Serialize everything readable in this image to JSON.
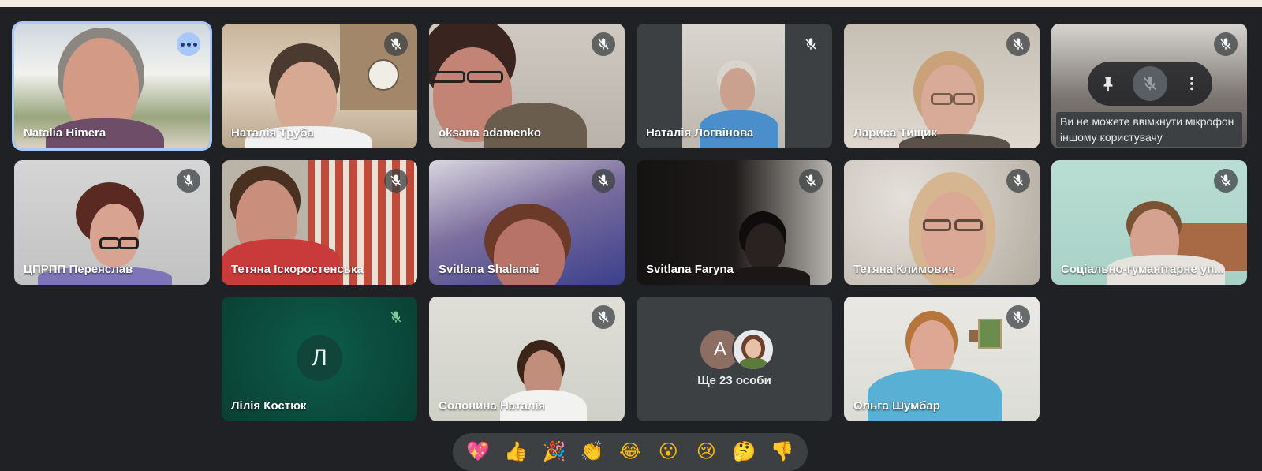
{
  "participants": [
    {
      "name": "Natalia Himera",
      "active": true
    },
    {
      "name": "Наталія Труба"
    },
    {
      "name": "oksana adamenko"
    },
    {
      "name": "Наталія Логвінова"
    },
    {
      "name": "Лариса Тищик"
    },
    {
      "name": "Ви не можете ввімкнути мікрофон іншому користувачу"
    },
    {
      "name": "ЦПРПП Переяслав"
    },
    {
      "name": "Тетяна Іскоростенська"
    },
    {
      "name": "Svitlana Shalamai"
    },
    {
      "name": "Svitlana Faryna"
    },
    {
      "name": "Тетяна Климович"
    },
    {
      "name": "Соціально-гуманітарне уп..."
    },
    {
      "name": "Лілія Костюк",
      "initial": "Л"
    },
    {
      "name": "Солонина Наталія"
    },
    {
      "name": "Ольга Шумбар"
    }
  ],
  "more_tile": {
    "avatar_letter": "A",
    "label": "Ще 23 особи"
  },
  "tooltip": "Ви не можете ввімкнути мікрофон іншому користувачу",
  "reactions": [
    "💖",
    "👍",
    "🎉",
    "👏",
    "😂",
    "😮",
    "😢",
    "🤔",
    "👎"
  ],
  "colors": {
    "background": "#202124",
    "tile": "#3c4043",
    "active_border": "#a8c7fa",
    "avatar_l": "#12453a"
  }
}
